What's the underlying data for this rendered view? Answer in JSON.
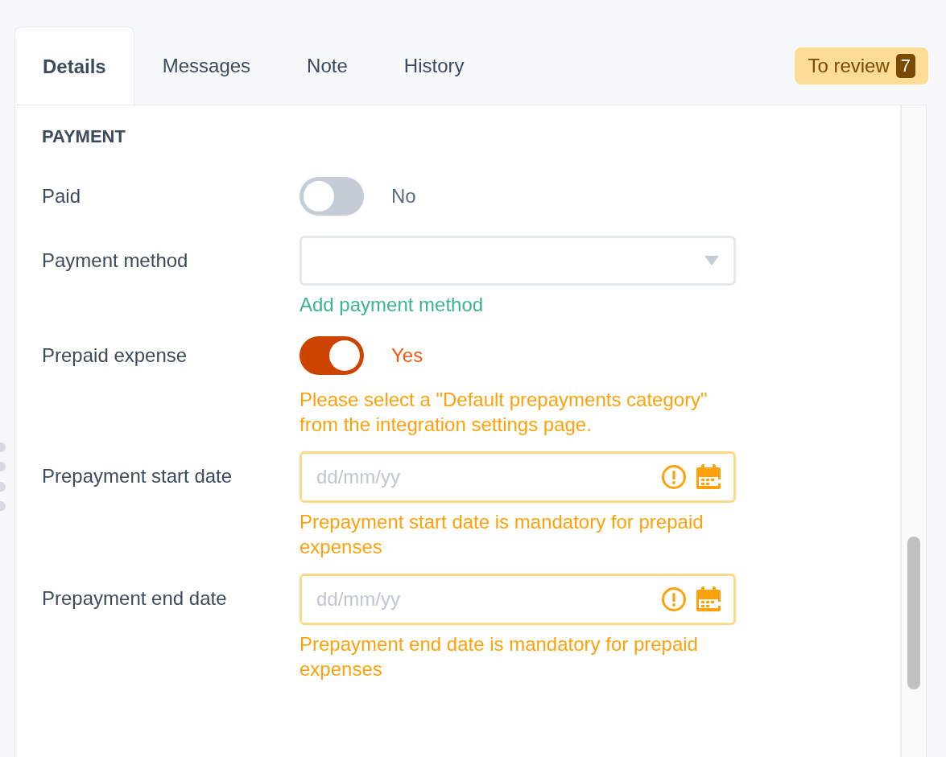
{
  "tabs": [
    {
      "label": "Details",
      "selected": true
    },
    {
      "label": "Messages",
      "selected": false
    },
    {
      "label": "Note",
      "selected": false
    },
    {
      "label": "History",
      "selected": false
    }
  ],
  "review_badge": {
    "label": "To review",
    "count": "7"
  },
  "section": {
    "title": "PAYMENT"
  },
  "fields": [
    {
      "kind": "toggle",
      "label": "Paid",
      "on": false,
      "value": "No"
    },
    {
      "kind": "select",
      "label": "Payment method",
      "link": "Add payment method"
    },
    {
      "kind": "toggle",
      "label": "Prepaid expense",
      "on": true,
      "value": "Yes",
      "warning": "Please select a \"Default prepayments category\" from the integration settings page."
    },
    {
      "kind": "date",
      "label": "Prepayment start date",
      "placeholder": "dd/mm/yy",
      "invalid": true,
      "warning": "Prepayment start date is mandatory for prepaid expenses"
    },
    {
      "kind": "date",
      "label": "Prepayment end date",
      "placeholder": "dd/mm/yy",
      "invalid": true,
      "warning": "Prepayment end date is mandatory for prepaid expenses"
    }
  ]
}
